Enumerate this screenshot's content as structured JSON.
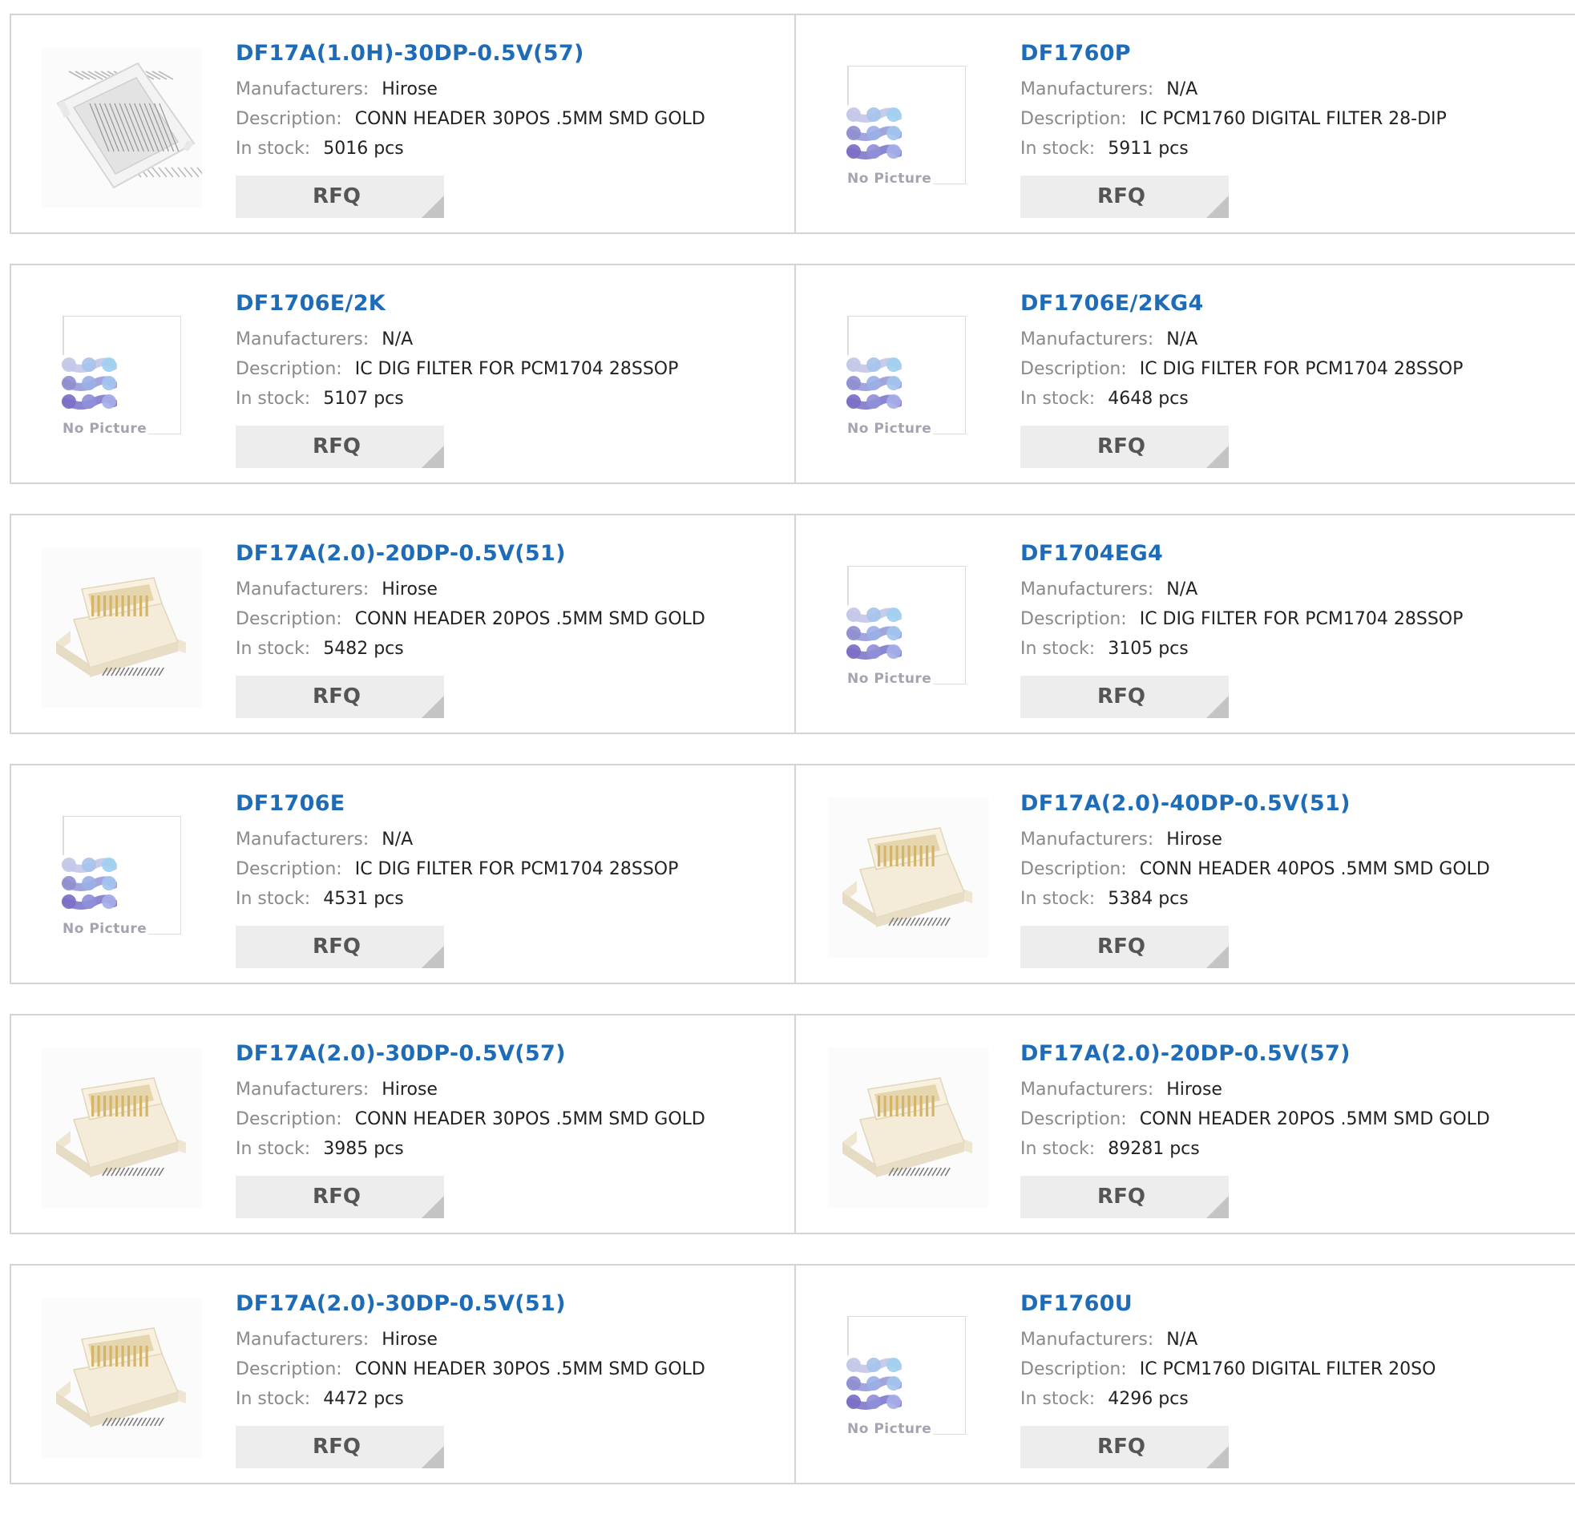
{
  "labels": {
    "manufacturers": "Manufacturers:",
    "description": "Description:",
    "in_stock": "In stock:",
    "rfq": "RFQ",
    "no_picture": "No Picture"
  },
  "products": [
    {
      "part": "DF17A(1.0H)-30DP-0.5V(57)",
      "manufacturer": "Hirose",
      "description": "CONN HEADER 30POS .5MM SMD GOLD",
      "stock": "5016 pcs",
      "image": "conn-flat"
    },
    {
      "part": "DF1760P",
      "manufacturer": "N/A",
      "description": "IC PCM1760 DIGITAL FILTER 28-DIP",
      "stock": "5911 pcs",
      "image": "no-picture"
    },
    {
      "part": "DF1706E/2K",
      "manufacturer": "N/A",
      "description": "IC DIG FILTER FOR PCM1704 28SSOP",
      "stock": "5107 pcs",
      "image": "no-picture"
    },
    {
      "part": "DF1706E/2KG4",
      "manufacturer": "N/A",
      "description": "IC DIG FILTER FOR PCM1704 28SSOP",
      "stock": "4648 pcs",
      "image": "no-picture"
    },
    {
      "part": "DF17A(2.0)-20DP-0.5V(51)",
      "manufacturer": "Hirose",
      "description": "CONN HEADER 20POS .5MM SMD GOLD",
      "stock": "5482 pcs",
      "image": "conn-3d"
    },
    {
      "part": "DF1704EG4",
      "manufacturer": "N/A",
      "description": "IC DIG FILTER FOR PCM1704 28SSOP",
      "stock": "3105 pcs",
      "image": "no-picture"
    },
    {
      "part": "DF1706E",
      "manufacturer": "N/A",
      "description": "IC DIG FILTER FOR PCM1704 28SSOP",
      "stock": "4531 pcs",
      "image": "no-picture"
    },
    {
      "part": "DF17A(2.0)-40DP-0.5V(51)",
      "manufacturer": "Hirose",
      "description": "CONN HEADER 40POS .5MM SMD GOLD",
      "stock": "5384 pcs",
      "image": "conn-3d"
    },
    {
      "part": "DF17A(2.0)-30DP-0.5V(57)",
      "manufacturer": "Hirose",
      "description": "CONN HEADER 30POS .5MM SMD GOLD",
      "stock": "3985 pcs",
      "image": "conn-3d"
    },
    {
      "part": "DF17A(2.0)-20DP-0.5V(57)",
      "manufacturer": "Hirose",
      "description": "CONN HEADER 20POS .5MM SMD GOLD",
      "stock": "89281 pcs",
      "image": "conn-3d"
    },
    {
      "part": "DF17A(2.0)-30DP-0.5V(51)",
      "manufacturer": "Hirose",
      "description": "CONN HEADER 30POS .5MM SMD GOLD",
      "stock": "4472 pcs",
      "image": "conn-3d"
    },
    {
      "part": "DF1760U",
      "manufacturer": "N/A",
      "description": "IC PCM1760 DIGITAL FILTER 20SO",
      "stock": "4296 pcs",
      "image": "no-picture"
    }
  ],
  "colors": {
    "link": "#1e6bb8",
    "label": "#8a8a8a",
    "button_bg": "#ededed",
    "border": "#d4d4d4"
  }
}
